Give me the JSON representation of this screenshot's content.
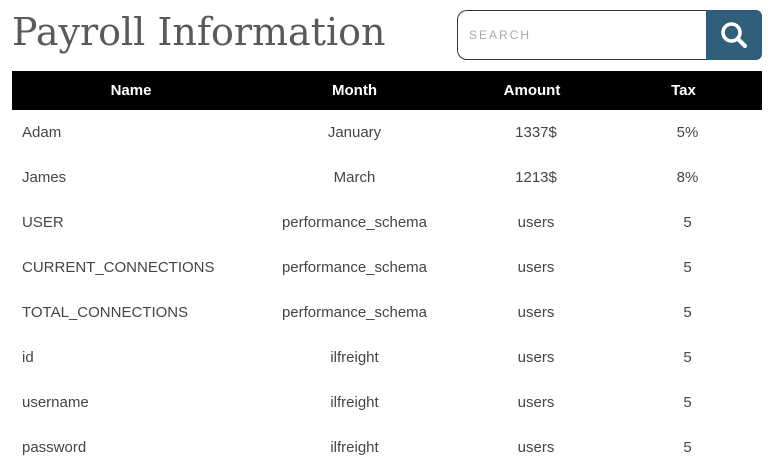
{
  "header": {
    "title": "Payroll Information"
  },
  "search": {
    "placeholder": "SEARCH",
    "value": "",
    "button_icon": "search-icon",
    "button_color": "#2f5f7b"
  },
  "table": {
    "columns": [
      "Name",
      "Month",
      "Amount",
      "Tax"
    ],
    "rows": [
      [
        "Adam",
        "January",
        "1337$",
        "5%"
      ],
      [
        "James",
        "March",
        "1213$",
        "8%"
      ],
      [
        "USER",
        "performance_schema",
        "users",
        "5"
      ],
      [
        "CURRENT_CONNECTIONS",
        "performance_schema",
        "users",
        "5"
      ],
      [
        "TOTAL_CONNECTIONS",
        "performance_schema",
        "users",
        "5"
      ],
      [
        "id",
        "ilfreight",
        "users",
        "5"
      ],
      [
        "username",
        "ilfreight",
        "users",
        "5"
      ],
      [
        "password",
        "ilfreight",
        "users",
        "5"
      ]
    ]
  }
}
